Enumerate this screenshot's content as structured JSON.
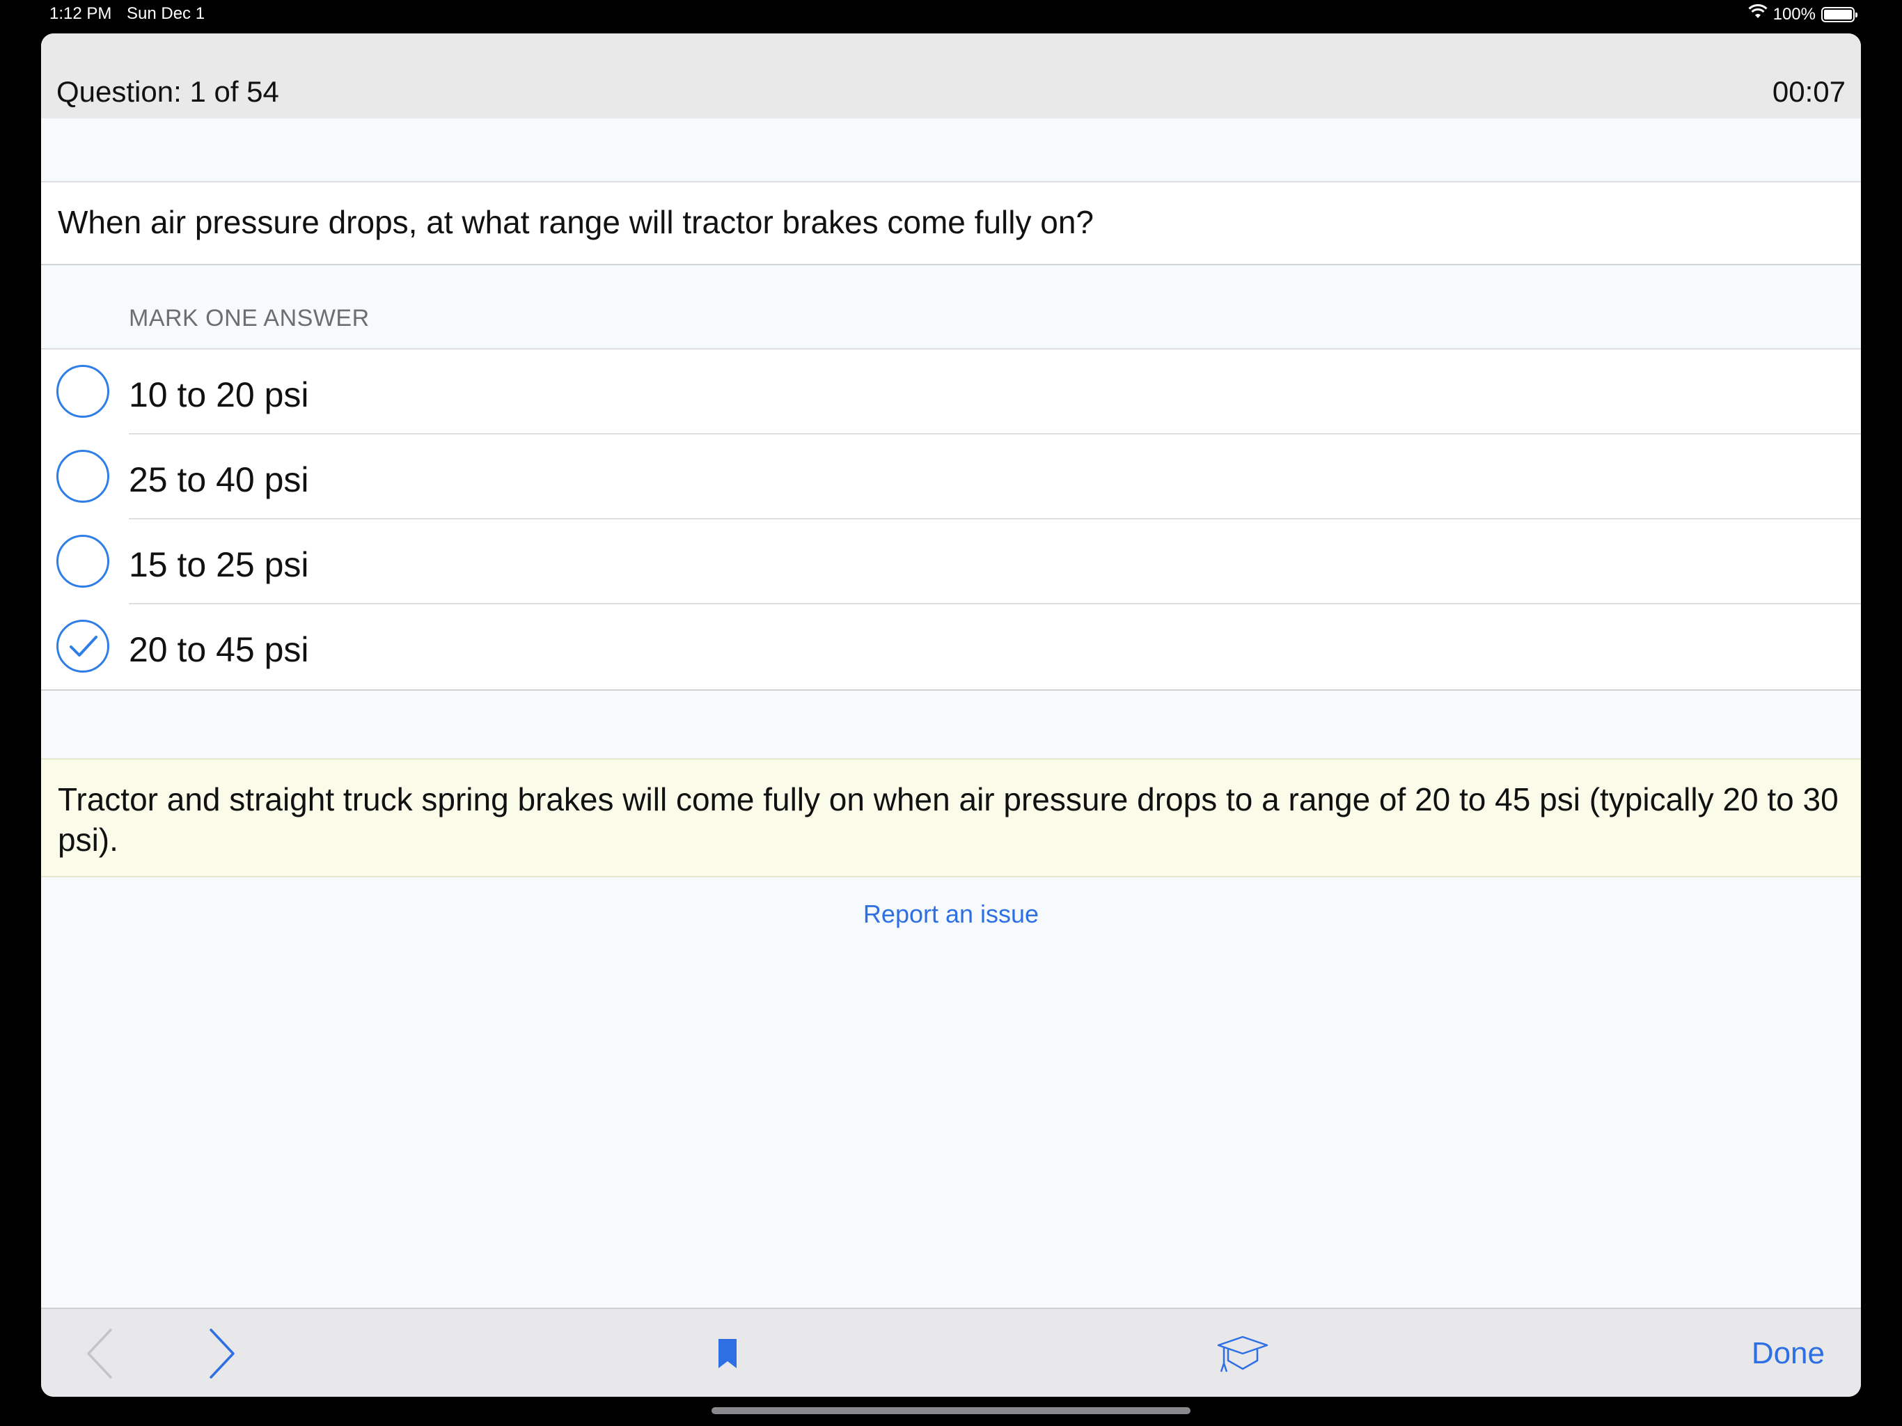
{
  "status_bar": {
    "time": "1:12 PM",
    "date": "Sun Dec 1",
    "battery_text": "100%",
    "icons": [
      "wifi-icon",
      "battery-icon"
    ]
  },
  "header": {
    "question_counter": "Question: 1 of 54",
    "timer": "00:07"
  },
  "question": {
    "text": "When air pressure drops, at what range will tractor brakes come fully on?"
  },
  "answers_section": {
    "label": "MARK ONE ANSWER",
    "options": [
      {
        "label": "10 to 20 psi",
        "selected": false
      },
      {
        "label": "25 to 40 psi",
        "selected": false
      },
      {
        "label": "15 to 25 psi",
        "selected": false
      },
      {
        "label": "20 to 45 psi",
        "selected": true
      }
    ]
  },
  "explanation": {
    "text": "Tractor and straight truck spring brakes will come fully on when air pressure drops to a range of 20 to 45 psi (typically 20 to 30 psi)."
  },
  "report_link": "Report an issue",
  "toolbar": {
    "icons": [
      "chevron-left-icon",
      "chevron-right-icon",
      "bookmark-icon",
      "graduation-cap-icon"
    ],
    "done_label": "Done"
  },
  "colors": {
    "accent": "#2f7ee8",
    "link": "#2f6fe4",
    "explanation_bg": "#fafbe8",
    "header_bg": "#e9e9ea"
  }
}
